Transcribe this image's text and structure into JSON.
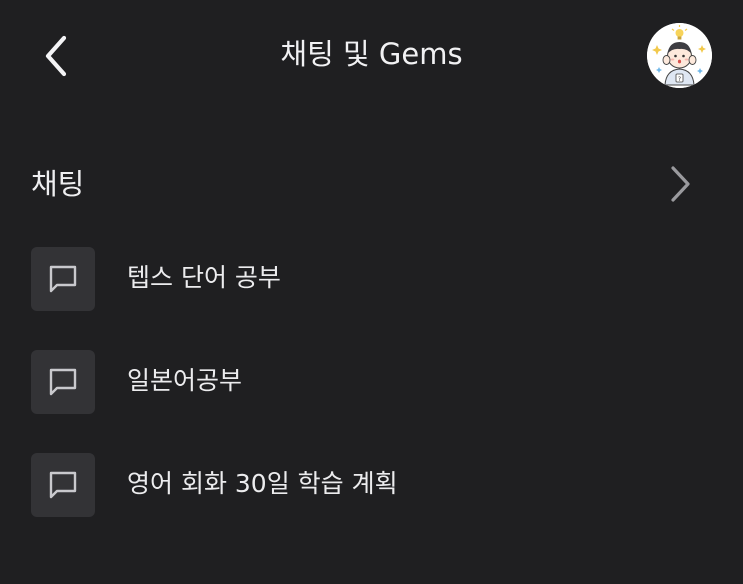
{
  "header": {
    "title": "채팅 및 Gems",
    "back_icon": "chevron-left-icon",
    "avatar_icon": "profile-avatar"
  },
  "section": {
    "title": "채팅",
    "more_icon": "chevron-right-icon"
  },
  "chats": [
    {
      "label": "텝스 단어 공부",
      "icon": "chat-bubble-icon"
    },
    {
      "label": "일본어공부",
      "icon": "chat-bubble-icon"
    },
    {
      "label": "영어 회화 30일 학습 계획",
      "icon": "chat-bubble-icon"
    }
  ],
  "colors": {
    "background": "#1f1f21",
    "icon_tile": "#333336",
    "text": "#ececee",
    "chevron_muted": "#9a9a9e"
  }
}
